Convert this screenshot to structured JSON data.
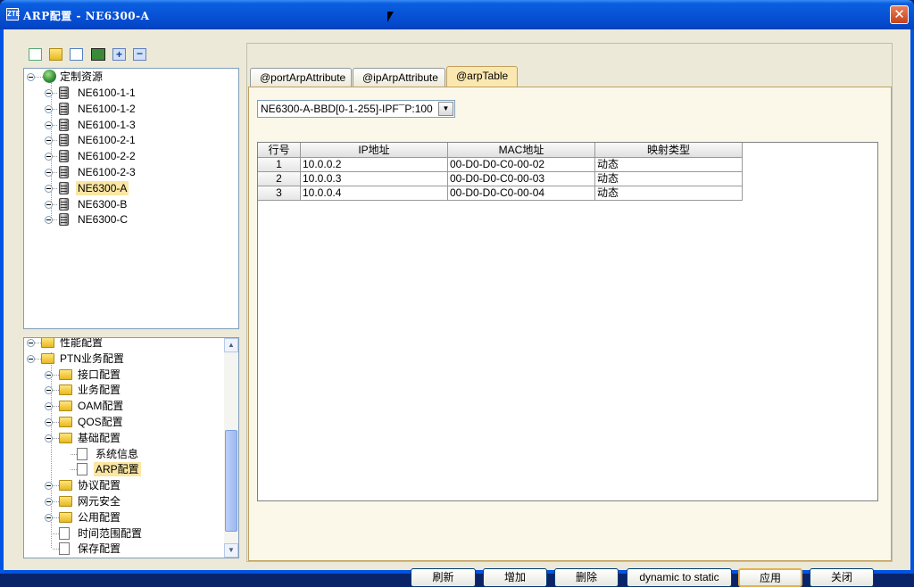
{
  "window": {
    "title": "ARP配置 - NE6300-A",
    "icon_text": "ZTE",
    "close_label": "✕"
  },
  "tree_top": {
    "root": "定制资源",
    "items": [
      "NE6100-1-1",
      "NE6100-1-2",
      "NE6100-1-3",
      "NE6100-2-1",
      "NE6100-2-2",
      "NE6100-2-3",
      "NE6300-A",
      "NE6300-B",
      "NE6300-C"
    ],
    "selected": "NE6300-A"
  },
  "tree_bottom": {
    "items": [
      {
        "label": "性能配置",
        "type": "folder"
      },
      {
        "label": "PTN业务配置",
        "type": "folder"
      },
      {
        "label": "接口配置",
        "type": "folder"
      },
      {
        "label": "业务配置",
        "type": "folder"
      },
      {
        "label": "OAM配置",
        "type": "folder"
      },
      {
        "label": "QOS配置",
        "type": "folder"
      },
      {
        "label": "基础配置",
        "type": "folder"
      },
      {
        "label": "系统信息",
        "type": "doc"
      },
      {
        "label": "ARP配置",
        "type": "doc"
      },
      {
        "label": "协议配置",
        "type": "folder"
      },
      {
        "label": "网元安全",
        "type": "folder"
      },
      {
        "label": "公用配置",
        "type": "folder"
      },
      {
        "label": "时间范围配置",
        "type": "doc"
      },
      {
        "label": "保存配置",
        "type": "doc"
      }
    ],
    "selected": "ARP配置"
  },
  "tabs": [
    "@portArpAttribute",
    "@ipArpAttribute",
    "@arpTable"
  ],
  "active_tab": "@arpTable",
  "interface_select": "NE6300-A-BBD[0-1-255]-IPF¯P:100",
  "table": {
    "headers": [
      "行号",
      "IP地址",
      "MAC地址",
      "映射类型"
    ],
    "rows": [
      [
        "1",
        "10.0.0.2",
        "00-D0-D0-C0-00-02",
        "动态"
      ],
      [
        "2",
        "10.0.0.3",
        "00-D0-D0-C0-00-03",
        "动态"
      ],
      [
        "3",
        "10.0.0.4",
        "00-D0-D0-C0-00-04",
        "动态"
      ]
    ]
  },
  "buttons": {
    "refresh": "刷新",
    "add": "增加",
    "delete": "删除",
    "dyn2static": "dynamic to static",
    "apply": "应用",
    "close": "关闭"
  },
  "icons": {
    "close": "close-icon",
    "globe": "globe-icon",
    "ne": "network-element-icon",
    "folder": "folder-icon",
    "doc": "document-icon"
  }
}
